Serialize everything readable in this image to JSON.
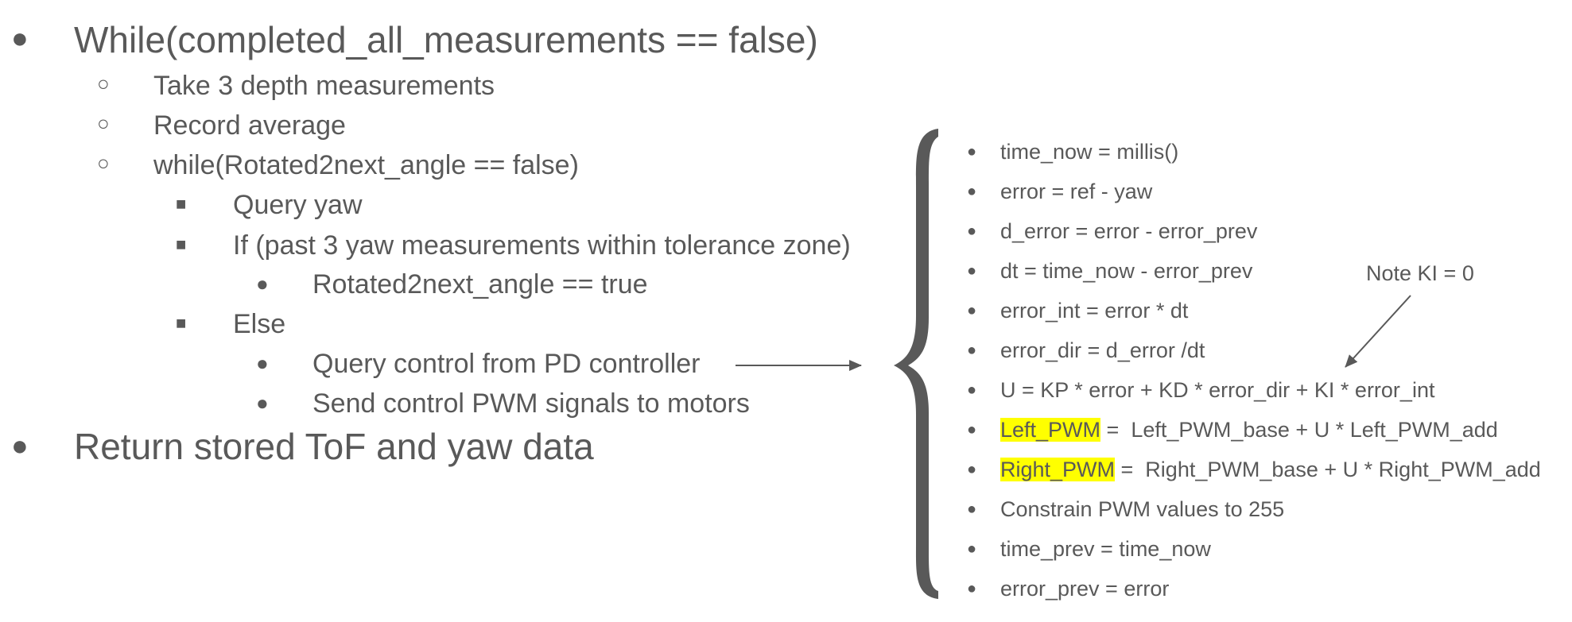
{
  "outline": {
    "items": [
      {
        "level": 1,
        "bullet": "●",
        "text": "While(completed_all_measurements == false)"
      },
      {
        "level": 2,
        "bullet": "○",
        "text": "Take 3 depth measurements"
      },
      {
        "level": 2,
        "bullet": "○",
        "text": "Record average"
      },
      {
        "level": 2,
        "bullet": "○",
        "text": "while(Rotated2next_angle == false)"
      },
      {
        "level": 3,
        "bullet": "■",
        "text": "Query yaw"
      },
      {
        "level": 3,
        "bullet": "■",
        "text": "If (past 3 yaw measurements within tolerance zone)"
      },
      {
        "level": 4,
        "bullet": "●",
        "text": "Rotated2next_angle == true"
      },
      {
        "level": 3,
        "bullet": "■",
        "text": "Else"
      },
      {
        "level": 4,
        "bullet": "●",
        "text": "Query control from PD controller"
      },
      {
        "level": 4,
        "bullet": "●",
        "text": "Send control PWM signals to motors"
      },
      {
        "level": 1,
        "bullet": "●",
        "text": "Return stored ToF and yaw data"
      }
    ]
  },
  "controller": {
    "bullet": "●",
    "lines": [
      {
        "text": "time_now = millis()"
      },
      {
        "text": "error = ref - yaw"
      },
      {
        "text": "d_error = error - error_prev"
      },
      {
        "text": "dt = time_now  - error_prev"
      },
      {
        "text": "error_int = error * dt"
      },
      {
        "text": "error_dir = d_error /dt"
      },
      {
        "text": "U = KP * error + KD * error_dir + KI * error_int"
      },
      {
        "highlight": "Left_PWM",
        "text": " =  Left_PWM_base + U * Left_PWM_add"
      },
      {
        "highlight": "Right_PWM",
        "text": " =  Right_PWM_base + U * Right_PWM_add"
      },
      {
        "text": "Constrain PWM values to 255"
      },
      {
        "text": "time_prev = time_now"
      },
      {
        "text": "error_prev = error"
      }
    ]
  },
  "note": {
    "text": "Note KI = 0"
  },
  "colors": {
    "text": "#595959",
    "highlight": "#ffff00",
    "brace": "#595959"
  }
}
